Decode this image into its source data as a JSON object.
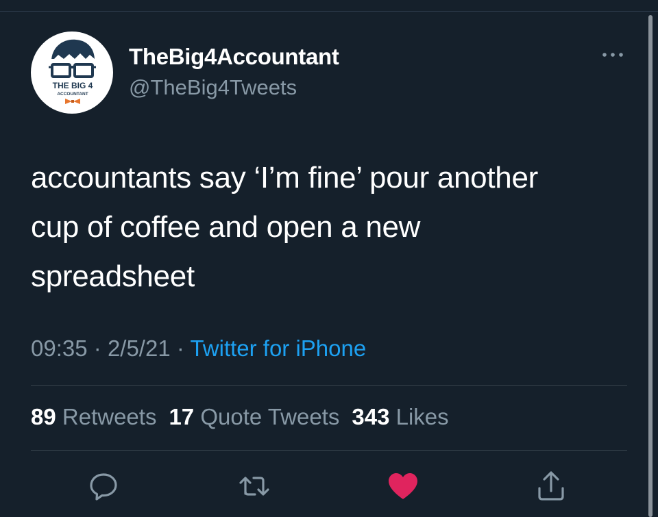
{
  "tweet": {
    "author": {
      "display_name": "TheBig4Accountant",
      "handle": "@TheBig4Tweets",
      "avatar_text_line1": "THE BIG 4",
      "avatar_text_line2": "ACCOUNTANT"
    },
    "text_lines": [
      "accountants say ‘I’m fine’ pour another",
      "cup of coffee and open a new",
      "spreadsheet"
    ],
    "time": "09:35",
    "separator": "·",
    "date": "2/5/21",
    "source": "Twitter for iPhone",
    "stats": {
      "retweets_count": "89",
      "retweets_label": "Retweets",
      "quotes_count": "17",
      "quotes_label": "Quote Tweets",
      "likes_count": "343",
      "likes_label": "Likes"
    }
  },
  "icons": {
    "more": "more-icon",
    "reply": "reply-icon",
    "retweet": "retweet-icon",
    "like": "like-icon",
    "share": "share-icon"
  },
  "colors": {
    "background": "#15202b",
    "primary_text": "#ffffff",
    "secondary_text": "#8899a6",
    "link": "#1da1f2",
    "like_active": "#e0245e",
    "divider": "#38444d"
  }
}
